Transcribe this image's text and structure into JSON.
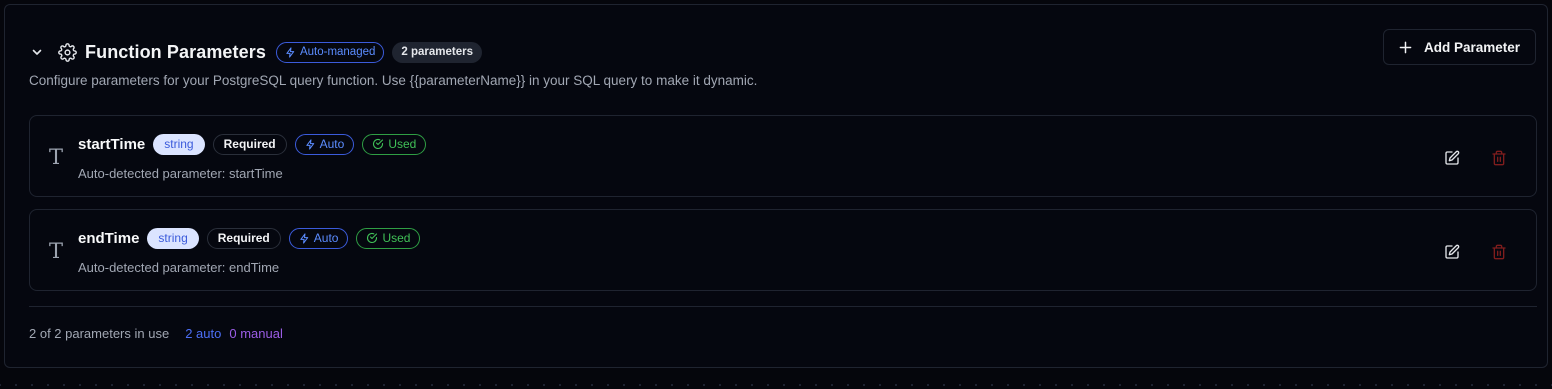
{
  "header": {
    "title": "Function Parameters",
    "auto_badge": "Auto-managed",
    "count_badge": "2 parameters",
    "add_button": "Add Parameter",
    "description": "Configure parameters for your PostgreSQL query function. Use {{parameterName}} in your SQL query to make it dynamic."
  },
  "parameters": [
    {
      "name": "startTime",
      "type": "string",
      "required": "Required",
      "auto": "Auto",
      "used": "Used",
      "description": "Auto-detected parameter: startTime"
    },
    {
      "name": "endTime",
      "type": "string",
      "required": "Required",
      "auto": "Auto",
      "used": "Used",
      "description": "Auto-detected parameter: endTime"
    }
  ],
  "footer": {
    "in_use": "2 of 2 parameters in use",
    "auto": "2 auto",
    "manual": "0 manual"
  },
  "icons": {
    "collapse": "chevron-down-icon",
    "settings": "gear-icon",
    "add": "plus-icon",
    "type": "text-type-icon",
    "edit": "edit-icon",
    "delete": "trash-icon",
    "auto": "lightning-icon",
    "used": "check-circle-icon"
  },
  "colors": {
    "background": "#05070f",
    "accent_blue": "#5b8cff",
    "used_green": "#40c057",
    "manual_purple": "#9b5de5",
    "delete_red": "#7f1d1d"
  }
}
